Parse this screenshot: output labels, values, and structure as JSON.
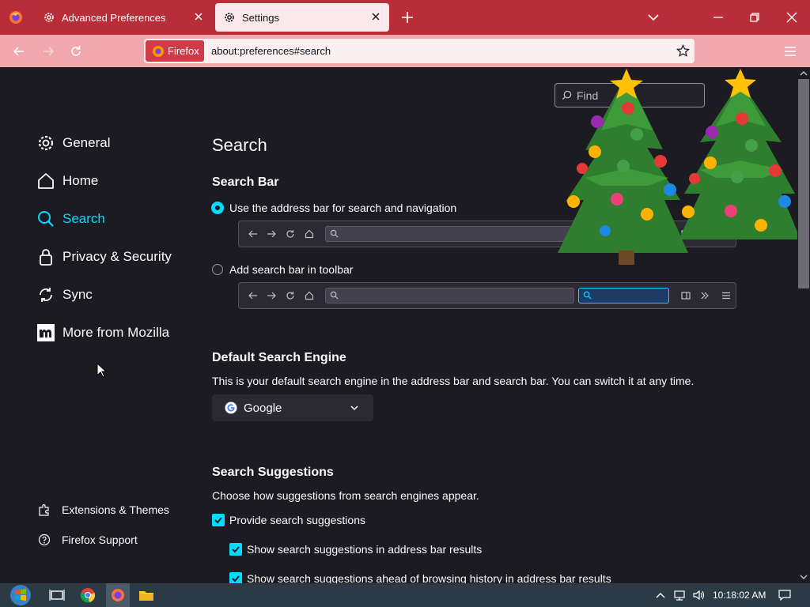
{
  "tabs": [
    {
      "label": "Advanced Preferences",
      "icon": "gear-icon",
      "active": false
    },
    {
      "label": "Settings",
      "icon": "gear-icon",
      "active": true
    }
  ],
  "urlbar": {
    "identity_label": "Firefox",
    "url": "about:preferences#search"
  },
  "find": {
    "placeholder": "Find in Settings",
    "visible_text": "Find"
  },
  "sidebar": {
    "categories": [
      {
        "label": "General",
        "icon": "gear-icon"
      },
      {
        "label": "Home",
        "icon": "home-icon"
      },
      {
        "label": "Search",
        "icon": "search-icon",
        "active": true
      },
      {
        "label": "Privacy & Security",
        "icon": "lock-icon"
      },
      {
        "label": "Sync",
        "icon": "sync-icon"
      },
      {
        "label": "More from Mozilla",
        "icon": "mozilla-icon"
      }
    ],
    "footer": [
      {
        "label": "Extensions & Themes",
        "icon": "puzzle-icon"
      },
      {
        "label": "Firefox Support",
        "icon": "help-icon"
      }
    ]
  },
  "main": {
    "title": "Search",
    "search_bar": {
      "heading": "Search Bar",
      "option_address": "Use the address bar for search and navigation",
      "option_toolbar": "Add search bar in toolbar",
      "selected": "address"
    },
    "default_engine": {
      "heading": "Default Search Engine",
      "description": "This is your default search engine in the address bar and search bar. You can switch it at any time.",
      "selected": "Google"
    },
    "suggestions": {
      "heading": "Search Suggestions",
      "description": "Choose how suggestions from search engines appear.",
      "items": [
        {
          "label": "Provide search suggestions",
          "checked": true
        },
        {
          "label": "Show search suggestions in address bar results",
          "checked": true
        },
        {
          "label": "Show search suggestions ahead of browsing history in address bar results",
          "checked": true
        }
      ]
    }
  },
  "taskbar": {
    "clock": "10:18:02 AM"
  },
  "colors": {
    "accent": "#00ddff",
    "tabstrip": "#b92d39",
    "navbar": "#f0a7ae",
    "background": "#1c1b22"
  }
}
